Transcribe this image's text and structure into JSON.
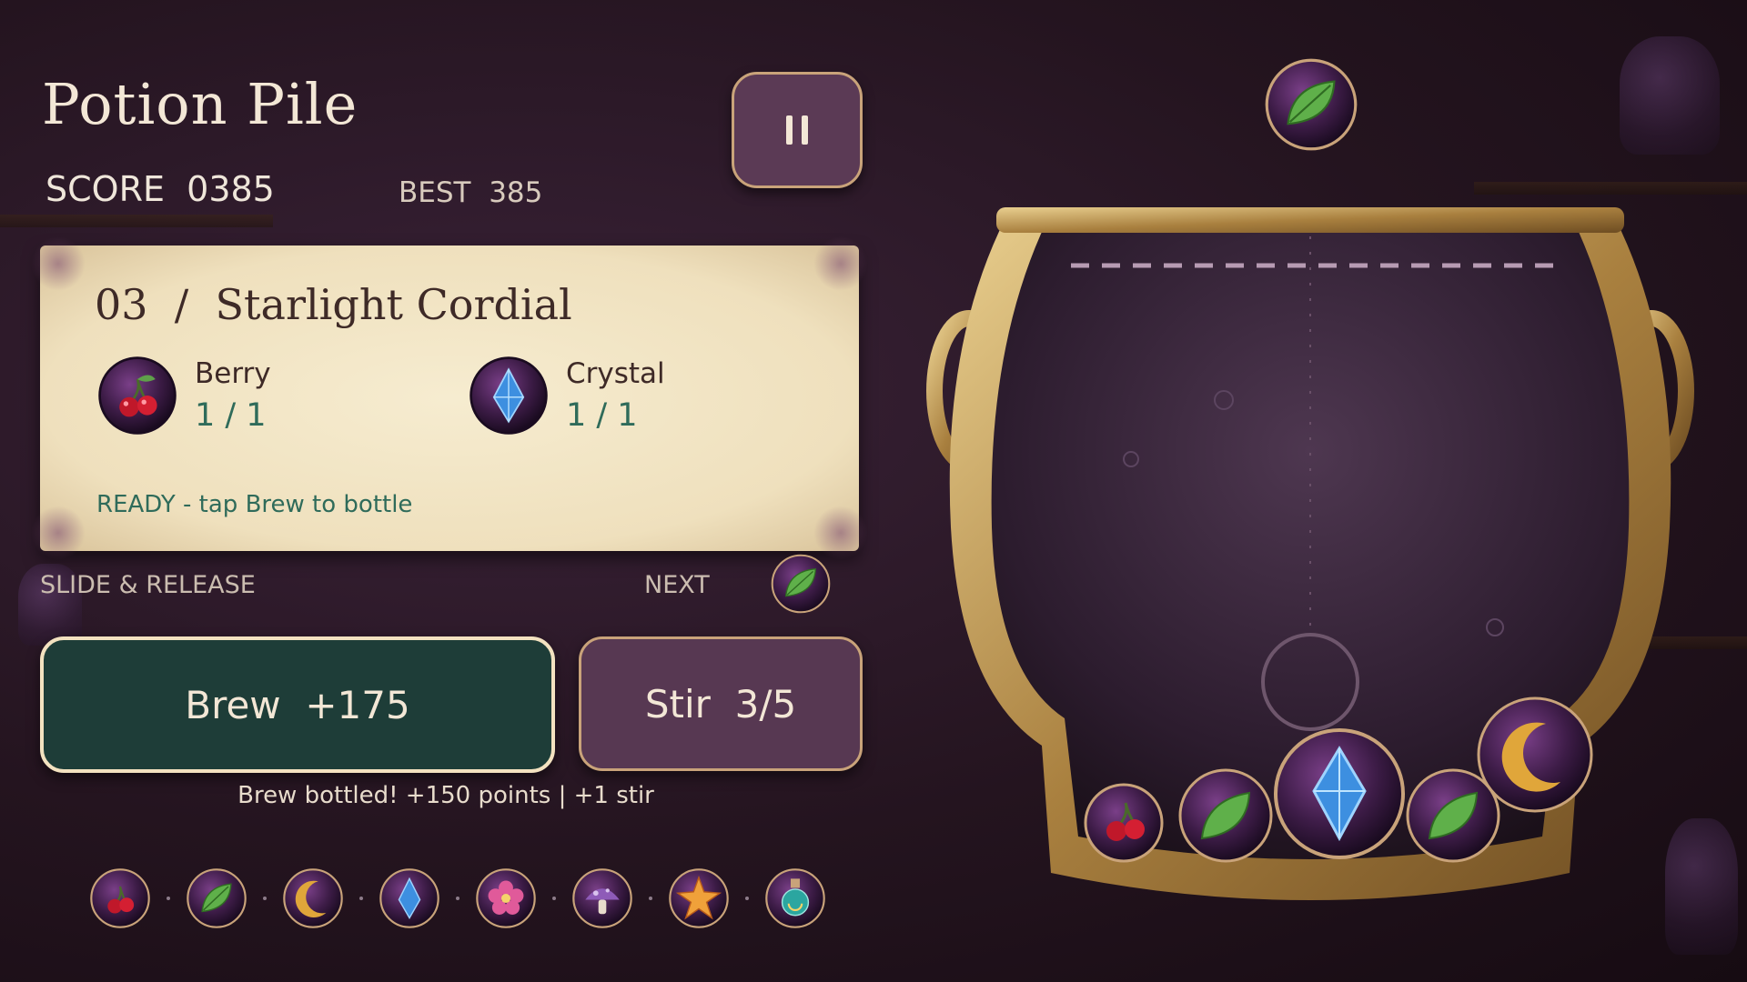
{
  "game": {
    "title": "Potion Pile",
    "score_label": "SCORE",
    "score_value": "0385",
    "best_label": "BEST",
    "best_value": "385"
  },
  "recipe": {
    "number": "03",
    "separator": "/",
    "name": "Starlight Cordial",
    "ingredients": [
      {
        "name": "Berry",
        "progress": "1 / 1",
        "icon": "cherry-icon"
      },
      {
        "name": "Crystal",
        "progress": "1 / 1",
        "icon": "crystal-icon"
      }
    ],
    "status": "READY - tap Brew to bottle"
  },
  "controls": {
    "slide_hint": "SLIDE & RELEASE",
    "next_label": "NEXT",
    "next_item": "leaf-icon",
    "brew_label": "Brew",
    "brew_points": "+175",
    "stir_label": "Stir",
    "stir_count": "3/5",
    "pause_icon": "pause-icon"
  },
  "message": "Brew bottled! +150 points  |  +1 stir",
  "ingredient_tray": [
    "cherry-icon",
    "leaf-icon",
    "moon-icon",
    "crystal-icon",
    "flower-icon",
    "mushroom-icon",
    "star-icon",
    "potion-icon"
  ],
  "cauldron_contents": [
    "cherry-icon",
    "leaf-icon",
    "crystal-icon",
    "leaf-icon",
    "moon-icon"
  ],
  "falling_item": "leaf-icon",
  "colors": {
    "brew_button": "#1e3d38",
    "stir_button": "#573852",
    "accent_gold": "#c9a37a",
    "ready_text": "#2f6b5a",
    "parchment": "#f3e6c8"
  }
}
